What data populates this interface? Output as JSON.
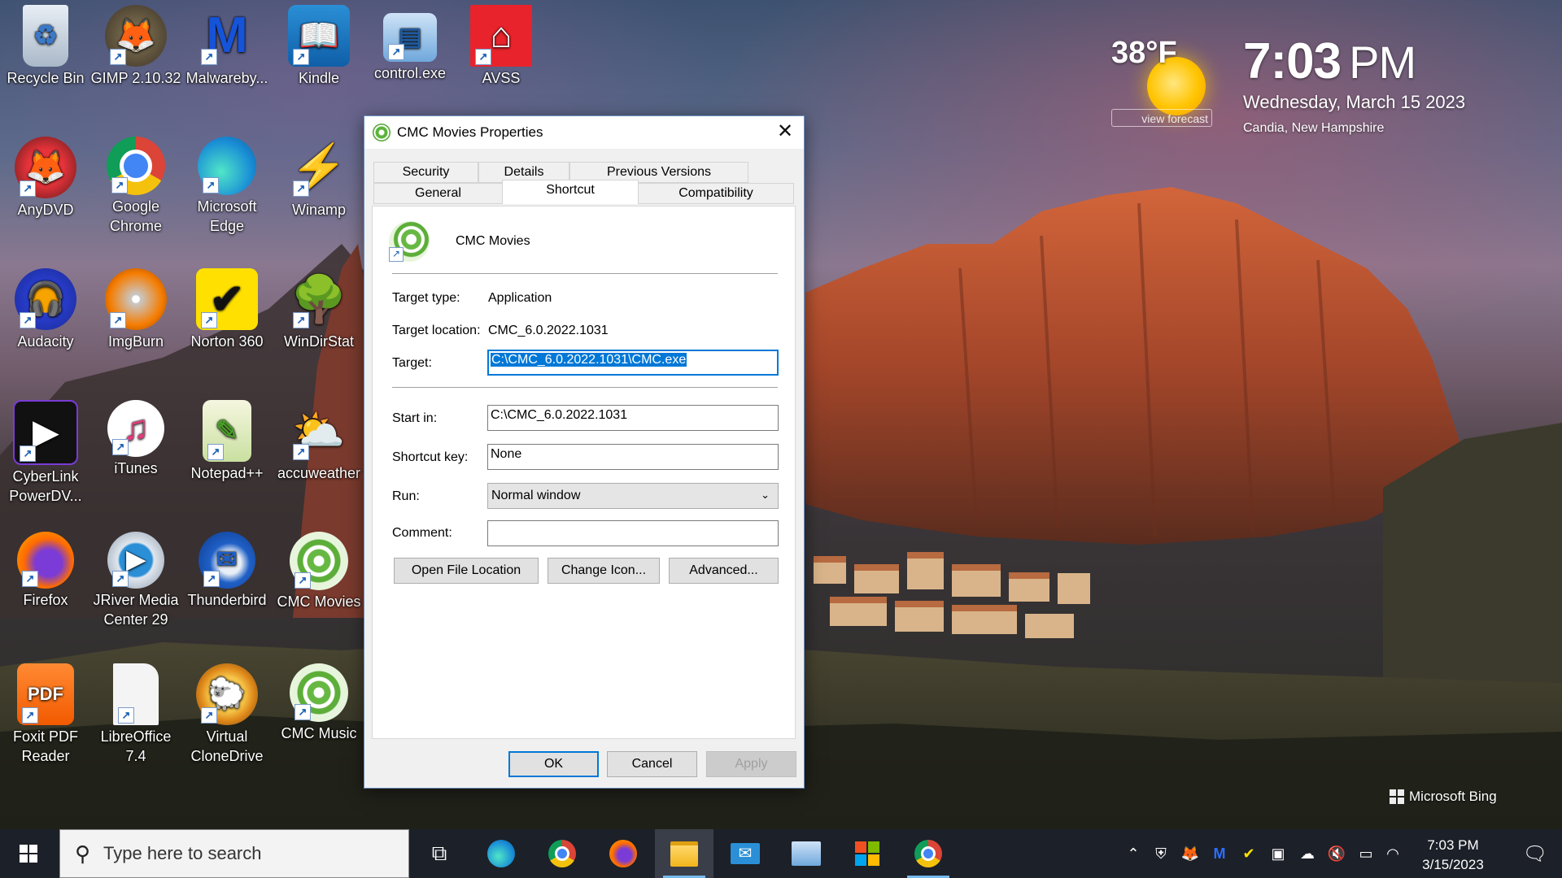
{
  "desktop": {
    "icons": [
      {
        "label": "Recycle Bin",
        "icon": "recycle-bin-icon"
      },
      {
        "label": "GIMP 2.10.32",
        "icon": "gimp-icon"
      },
      {
        "label": "Malwareby...",
        "icon": "malwarebytes-icon"
      },
      {
        "label": "Kindle",
        "icon": "kindle-icon"
      },
      {
        "label": "control.exe",
        "icon": "control-panel-icon"
      },
      {
        "label": "AVSS",
        "icon": "avss-icon"
      },
      {
        "label": "AnyDVD",
        "icon": "anydvd-icon"
      },
      {
        "label": "Google Chrome",
        "icon": "chrome-icon"
      },
      {
        "label": "Microsoft Edge",
        "icon": "edge-icon"
      },
      {
        "label": "Winamp",
        "icon": "winamp-icon"
      },
      {
        "label": "Audacity",
        "icon": "audacity-icon"
      },
      {
        "label": "ImgBurn",
        "icon": "imgburn-icon"
      },
      {
        "label": "Norton 360",
        "icon": "norton-icon"
      },
      {
        "label": "WinDirStat",
        "icon": "windirstat-icon"
      },
      {
        "label": "CyberLink PowerDV...",
        "icon": "powerdvd-icon"
      },
      {
        "label": "iTunes",
        "icon": "itunes-icon"
      },
      {
        "label": "Notepad++",
        "icon": "notepadpp-icon"
      },
      {
        "label": "accuweather",
        "icon": "accuweather-icon"
      },
      {
        "label": "Firefox",
        "icon": "firefox-icon"
      },
      {
        "label": "JRiver Media Center 29",
        "icon": "jriver-icon"
      },
      {
        "label": "Thunderbird",
        "icon": "thunderbird-icon"
      },
      {
        "label": "CMC Movies",
        "icon": "cmc-movies-icon"
      },
      {
        "label": "Foxit PDF Reader",
        "icon": "foxit-icon"
      },
      {
        "label": "LibreOffice 7.4",
        "icon": "libreoffice-icon"
      },
      {
        "label": "Virtual CloneDrive",
        "icon": "clonedrive-icon"
      },
      {
        "label": "CMC Music",
        "icon": "cmc-music-icon"
      }
    ]
  },
  "weather": {
    "temp": "38°F",
    "forecast": "view forecast"
  },
  "clock_widget": {
    "time": "7:03",
    "ampm": "PM",
    "date": "Wednesday, March 15 2023",
    "location": "Candia, New Hampshire"
  },
  "watermark": "Microsoft Bing",
  "dialog": {
    "title": "CMC Movies Properties",
    "tabs_row1": [
      "Security",
      "Details",
      "Previous Versions"
    ],
    "tabs_row2": [
      "General",
      "Shortcut",
      "Compatibility"
    ],
    "active_tab": "Shortcut",
    "shortcut_name": "CMC Movies",
    "target_type_label": "Target type:",
    "target_type_value": "Application",
    "target_location_label": "Target location:",
    "target_location_value": "CMC_6.0.2022.1031",
    "target_label": "Target:",
    "target_value": "C:\\CMC_6.0.2022.1031\\CMC.exe",
    "start_in_label": "Start in:",
    "start_in_value": "C:\\CMC_6.0.2022.1031",
    "shortcut_key_label": "Shortcut key:",
    "shortcut_key_value": "None",
    "run_label": "Run:",
    "run_value": "Normal window",
    "comment_label": "Comment:",
    "comment_value": "",
    "open_file_location": "Open File Location",
    "change_icon": "Change Icon...",
    "advanced": "Advanced...",
    "ok": "OK",
    "cancel": "Cancel",
    "apply": "Apply"
  },
  "taskbar": {
    "search_placeholder": "Type here to search",
    "apps": [
      "task-view-icon",
      "edge-icon",
      "chrome-icon",
      "firefox-icon",
      "file-explorer-icon",
      "mail-icon",
      "control-panel-icon",
      "store-icon",
      "chrome-icon"
    ],
    "time": "7:03 PM",
    "date": "3/15/2023"
  }
}
